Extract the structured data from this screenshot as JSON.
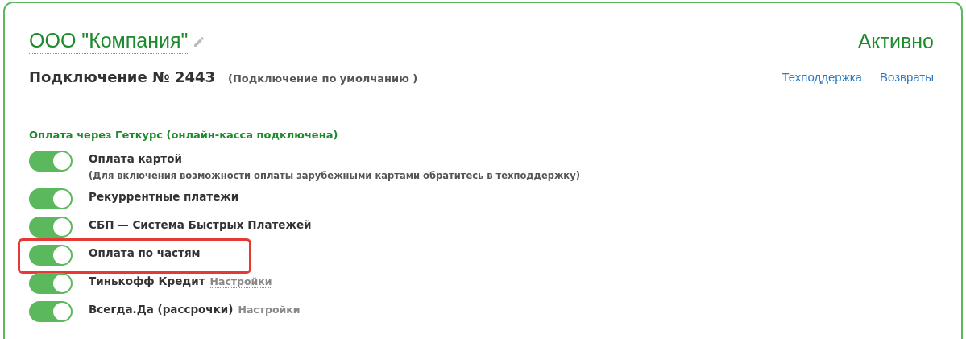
{
  "company": {
    "name": "ООО \"Компания\"",
    "status": "Активно"
  },
  "connection": {
    "title": "Подключение № 2443",
    "note": "(Подключение по умолчанию )",
    "links": [
      "Техподдержка",
      "Возвраты"
    ]
  },
  "section": {
    "title": "Оплата через Геткурс (онлайн-касса подключена)"
  },
  "options": [
    {
      "label": "Оплата картой",
      "note": "(Для включения возможности оплаты зарубежными картами обратитесь в техподдержку)",
      "on": true,
      "highlighted": false
    },
    {
      "label": "Рекуррентные платежи",
      "on": true,
      "highlighted": false
    },
    {
      "label": "СБП — Система Быстрых Платежей",
      "on": true,
      "highlighted": false
    },
    {
      "label": "Оплата по частям",
      "on": true,
      "highlighted": true
    },
    {
      "label": "Тинькофф Кредит",
      "settings": "Настройки",
      "on": true,
      "highlighted": false
    },
    {
      "label": "Всегда.Да (рассрочки)",
      "settings": "Настройки",
      "on": true,
      "highlighted": false
    }
  ]
}
